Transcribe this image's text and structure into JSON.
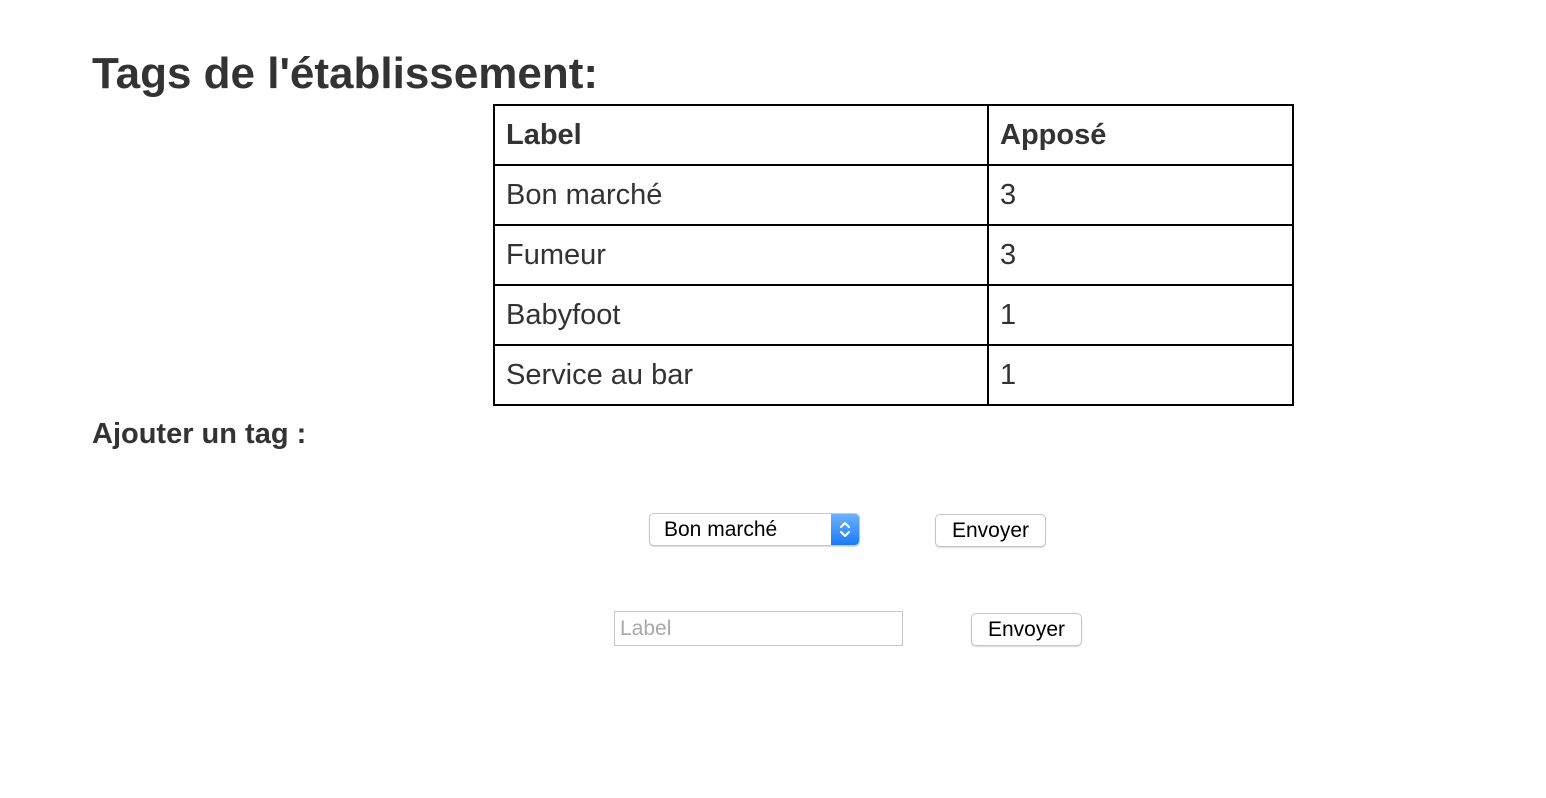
{
  "page": {
    "title": "Tags de l'établissement:",
    "add_heading": "Ajouter un tag :"
  },
  "table": {
    "headers": [
      "Label",
      "Apposé"
    ],
    "rows": [
      [
        "Bon marché",
        "3"
      ],
      [
        "Fumeur",
        "3"
      ],
      [
        "Babyfoot",
        "1"
      ],
      [
        "Service au bar",
        "1"
      ]
    ]
  },
  "form": {
    "select": {
      "selected_value": "Bon marché",
      "icon": "select-arrows-icon",
      "accent_color": "#1a7cf5"
    },
    "send_button_1": "Envoyer",
    "label_input": {
      "value": "",
      "placeholder": "Label"
    },
    "send_button_2": "Envoyer"
  }
}
